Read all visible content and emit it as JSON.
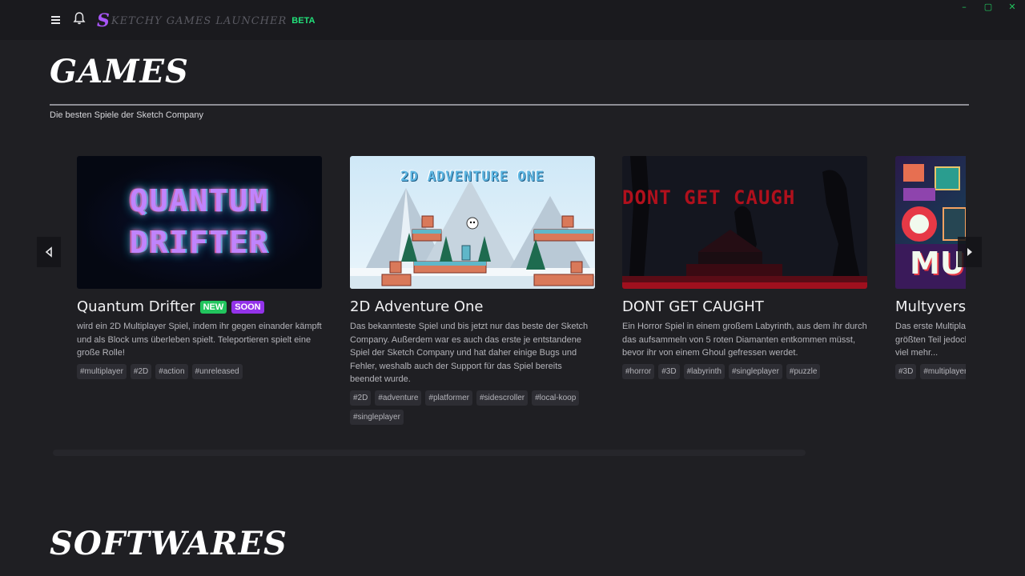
{
  "app": {
    "logo_initial": "S",
    "logo_name": "Ketchy Games Launcher",
    "logo_badge": "BETA",
    "window_controls": [
      "–",
      "▢",
      "✕"
    ]
  },
  "games_section": {
    "title": "Games",
    "subtitle": "Die besten Spiele der Sketch Company"
  },
  "games": [
    {
      "title": "Quantum Drifter",
      "badges": [
        "NEW",
        "SOON"
      ],
      "thumb_text": [
        "QUANTUM",
        "DRIFTER"
      ],
      "description": "wird ein 2D Multiplayer Spiel, indem ihr gegen einander kämpft und als Block ums überleben spielt. Teleportieren spielt eine große Rolle!",
      "tags": [
        "#multiplayer",
        "#2D",
        "#action",
        "#unreleased"
      ]
    },
    {
      "title": "2D Adventure One",
      "thumb_text": [
        "2D ADVENTURE ONE"
      ],
      "description": "Das bekannteste Spiel und bis jetzt nur das beste der Sketch Company. Außerdem war es auch das erste je entstandene Spiel der Sketch Company und hat daher einige Bugs und Fehler, weshalb auch der Support für das Spiel bereits beendet wurde.",
      "tags": [
        "#2D",
        "#adventure",
        "#platformer",
        "#sidescroller",
        "#local-koop",
        "#singleplayer"
      ]
    },
    {
      "title": "DONT GET CAUGHT",
      "thumb_text": [
        "DONT GET CAUGH"
      ],
      "description": "Ein Horror Spiel in einem großem Labyrinth, aus dem ihr durch das aufsammeln von 5 roten Diamanten entkommen müsst, bevor ihr von einem Ghoul gefressen werdet.",
      "tags": [
        "#horror",
        "#3D",
        "#labyrinth",
        "#singleplayer",
        "#puzzle"
      ]
    },
    {
      "title": "Multyverse",
      "thumb_text": [
        "MU"
      ],
      "description": "Das erste Multiplayer Spiel der Sketch Company, welches zum größten Teil jedoch nicht fertig gestellt wurde. Das Spiel nicht viel mehr...",
      "tags": [
        "#3D",
        "#multiplayer"
      ]
    }
  ],
  "softwares_section": {
    "title": "Softwares"
  },
  "colors": {
    "accent_purple": "#a855f7",
    "beta_green": "#22e07a",
    "badge_new": "#22c55e",
    "badge_soon": "#9333ea"
  }
}
